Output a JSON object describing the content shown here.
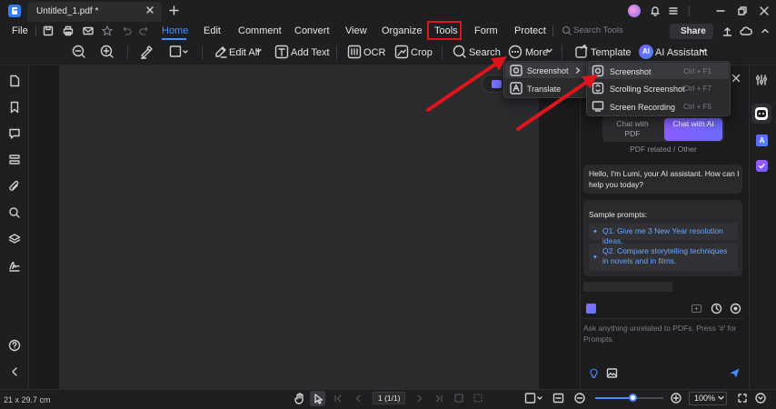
{
  "window": {
    "tab_title": "Untitled_1.pdf *"
  },
  "menu": {
    "file": "File",
    "tabs": [
      "Home",
      "Edit",
      "Comment",
      "Convert",
      "View",
      "Organize",
      "Tools",
      "Form",
      "Protect"
    ],
    "active_tab": "Home",
    "highlighted_tab": "Tools",
    "search_placeholder": "Search Tools",
    "share": "Share"
  },
  "toolbar": {
    "edit_all": "Edit All",
    "add_text": "Add Text",
    "ocr": "OCR",
    "crop": "Crop",
    "search": "Search",
    "more": "More",
    "template": "Template",
    "ai_assistant": "AI Assistant"
  },
  "more_menu": {
    "items": [
      {
        "label": "Screenshot",
        "icon": "camera-icon",
        "has_submenu": true
      },
      {
        "label": "Translate",
        "icon": "translate-icon",
        "has_submenu": false
      }
    ]
  },
  "screenshot_submenu": {
    "items": [
      {
        "label": "Screenshot",
        "shortcut": "Ctrl + F1"
      },
      {
        "label": "Scrolling Screenshot",
        "shortcut": "Ctrl + F7"
      },
      {
        "label": "Screen Recording",
        "shortcut": "Ctrl + F5"
      }
    ]
  },
  "ai_panel": {
    "chat_with_pdf": "Chat with PDF",
    "chat_with_ai": "Chat with AI",
    "scope_note": "PDF related / Other",
    "greeting": "Hello, I'm Lumi, your AI assistant. How can I help you today?",
    "sample_prompts_title": "Sample prompts:",
    "prompts": [
      "Q1. Give me 3 New Year resolution ideas.",
      "Q2. Compare storytelling techniques in novels and in films."
    ],
    "input_placeholder": "Ask anything unrelated to PDFs. Press '#' for Prompts."
  },
  "status": {
    "page_size": "21 x 29.7 cm",
    "page_indicator": "1 (1/1)",
    "zoom": "100%",
    "zoom_slider_fraction": 0.55
  },
  "colors": {
    "accent": "#4a8cff",
    "ai_purple": "#7b5cff",
    "highlight_red": "#e0151c"
  }
}
